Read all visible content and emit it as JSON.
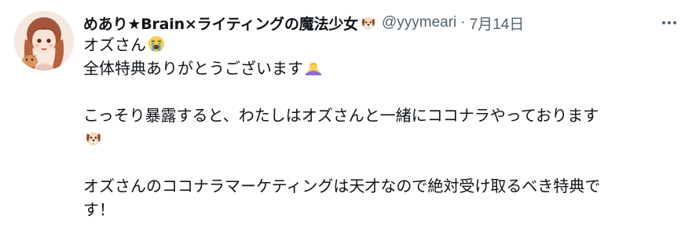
{
  "tweet": {
    "display_name": "めあり★Brain×ライティングの魔法少女",
    "name_emoji": "dog-face-emoji",
    "handle": "@yyymeari",
    "separator": "·",
    "date": "7月14日",
    "lines": [
      {
        "text": "オズさん",
        "emoji": "loudly-crying-face-emoji"
      },
      {
        "text": "全体特典ありがとうございます",
        "emoji": "person-bowing-emoji"
      },
      {
        "text": ""
      },
      {
        "text": "こっそり暴露すると、わたしはオズさんと一緒にココナラやっております"
      },
      {
        "text": "",
        "emoji": "dog-face-emoji"
      },
      {
        "text": ""
      },
      {
        "text": "オズさんのココナラマーケティングは天才なので絶対受け取るべき特典で"
      },
      {
        "text": "す！"
      }
    ]
  },
  "colors": {
    "text": "#0f1419",
    "secondary": "#536471",
    "background": "#ffffff"
  }
}
